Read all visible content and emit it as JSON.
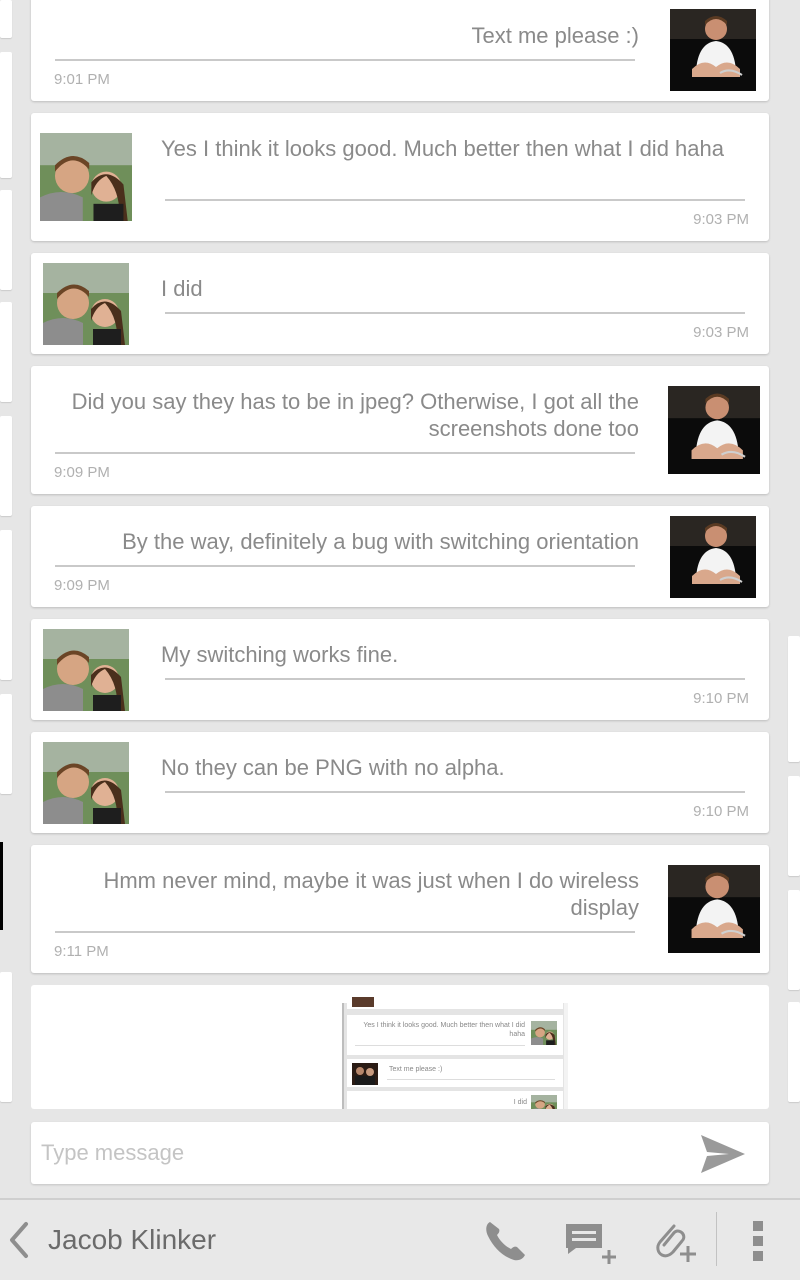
{
  "messages": [
    {
      "text": "Text me please :)",
      "time": "9:01 PM",
      "direction": "sent"
    },
    {
      "text": "Yes I think it looks good. Much better then what I did haha",
      "time": "9:03 PM",
      "direction": "received"
    },
    {
      "text": "I did",
      "time": "9:03 PM",
      "direction": "received"
    },
    {
      "text": "Did you say they has to be in jpeg? Otherwise, I got all the screenshots done too",
      "time": "9:09 PM",
      "direction": "sent"
    },
    {
      "text": "By the way, definitely a bug with switching orientation",
      "time": "9:09 PM",
      "direction": "sent"
    },
    {
      "text": "My switching works fine.",
      "time": "9:10 PM",
      "direction": "received"
    },
    {
      "text": "No they can be PNG with no alpha.",
      "time": "9:10 PM",
      "direction": "received"
    },
    {
      "text": "Hmm never mind, maybe it was just when I do wireless display",
      "time": "9:11 PM",
      "direction": "sent"
    }
  ],
  "mms_preview": {
    "rows": [
      "Yes I think it looks good. Much better then what I did haha",
      "Text me please :)",
      "I did"
    ]
  },
  "compose": {
    "placeholder": "Type message"
  },
  "actionbar": {
    "contact_name": "Jacob Klinker",
    "icons": [
      "back-icon",
      "phone-icon",
      "new-message-icon",
      "attach-icon",
      "overflow-menu-icon"
    ]
  },
  "colors": {
    "background": "#e6e6e6",
    "card": "#ffffff",
    "text": "#8a8a8a",
    "icon": "#8e8e8e"
  }
}
